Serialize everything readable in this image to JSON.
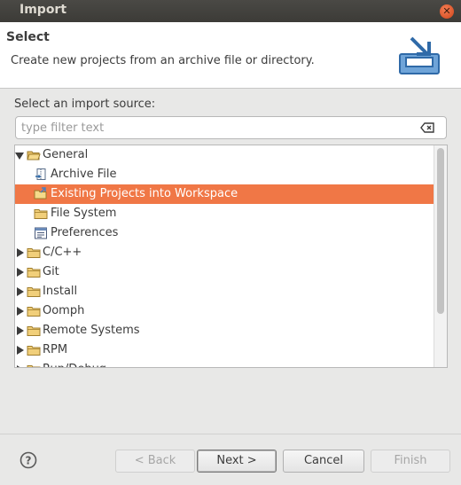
{
  "window": {
    "title": "Import",
    "close_icon": "close-icon"
  },
  "header": {
    "title": "Select",
    "description": "Create new projects from an archive file or directory.",
    "icon": "import-icon"
  },
  "source": {
    "label": "Select an import source:",
    "filter_placeholder": "type filter text",
    "filter_value": ""
  },
  "tree": {
    "items": [
      {
        "label": "General",
        "level": 0,
        "expanded": true,
        "icon": "folder-open-icon"
      },
      {
        "label": "Archive File",
        "level": 1,
        "icon": "archive-file-icon"
      },
      {
        "label": "Existing Projects into Workspace",
        "level": 1,
        "icon": "projects-icon",
        "selected": true
      },
      {
        "label": "File System",
        "level": 1,
        "icon": "folder-icon"
      },
      {
        "label": "Preferences",
        "level": 1,
        "icon": "preferences-icon"
      },
      {
        "label": "C/C++",
        "level": 0,
        "expanded": false,
        "icon": "folder-icon"
      },
      {
        "label": "Git",
        "level": 0,
        "expanded": false,
        "icon": "folder-icon"
      },
      {
        "label": "Install",
        "level": 0,
        "expanded": false,
        "icon": "folder-icon"
      },
      {
        "label": "Oomph",
        "level": 0,
        "expanded": false,
        "icon": "folder-icon"
      },
      {
        "label": "Remote Systems",
        "level": 0,
        "expanded": false,
        "icon": "folder-icon"
      },
      {
        "label": "RPM",
        "level": 0,
        "expanded": false,
        "icon": "folder-icon"
      },
      {
        "label": "Run/Debug",
        "level": 0,
        "expanded": false,
        "icon": "folder-icon"
      }
    ]
  },
  "buttons": {
    "help_icon": "help-icon",
    "back": "< Back",
    "next": "Next >",
    "cancel": "Cancel",
    "finish": "Finish"
  },
  "colors": {
    "selection": "#f07746",
    "titlebar": "#3c3b37"
  }
}
